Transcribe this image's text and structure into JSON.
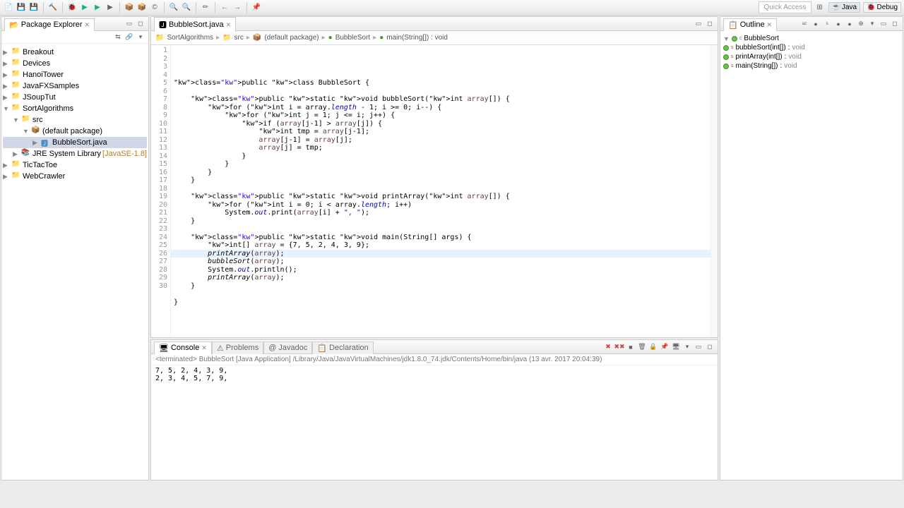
{
  "quickAccess": {
    "placeholder": "Quick Access"
  },
  "perspectives": {
    "java": "Java",
    "debug": "Debug"
  },
  "packageExplorer": {
    "title": "Package Explorer",
    "projects": [
      "Breakout",
      "Devices",
      "HanoiTower",
      "JavaFXSamples",
      "JSoupTut",
      "SortAlgorithms",
      "TicTacToe",
      "WebCrawler"
    ],
    "sort": {
      "src": "src",
      "defaultPkg": "(default package)",
      "file": "BubbleSort.java",
      "jre": "JRE System Library",
      "jreVer": "[JavaSE-1.8]"
    }
  },
  "editor": {
    "tab": "BubbleSort.java",
    "breadcrumb": {
      "project": "SortAlgorithms",
      "src": "src",
      "pkg": "(default package)",
      "class": "BubbleSort",
      "method": "main(String[]) : void"
    },
    "code": [
      "",
      "public class BubbleSort {",
      "",
      "    public static void bubbleSort(int array[]) {",
      "        for (int i = array.length - 1; i >= 0; i--) {",
      "            for (int j = 1; j <= i; j++) {",
      "                if (array[j-1] > array[j]) {",
      "                    int tmp = array[j-1];",
      "                    array[j-1] = array[j];",
      "                    array[j] = tmp;",
      "                }",
      "            }",
      "        }",
      "    }",
      "",
      "    public static void printArray(int array[]) {",
      "        for (int i = 0; i < array.length; i++)",
      "            System.out.print(array[i] + \", \");",
      "    }",
      "",
      "    public static void main(String[] args) {",
      "        int[] array = {7, 5, 2, 4, 3, 9};",
      "        printArray(array);",
      "        bubbleSort(array);",
      "        System.out.println();",
      "        printArray(array);",
      "    }",
      "",
      "}",
      ""
    ],
    "highlightLine": 26
  },
  "outline": {
    "title": "Outline",
    "class": "BubbleSort",
    "methods": [
      {
        "name": "bubbleSort(int[])",
        "ret": "void"
      },
      {
        "name": "printArray(int[])",
        "ret": "void"
      },
      {
        "name": "main(String[])",
        "ret": "void"
      }
    ]
  },
  "bottomTabs": {
    "console": "Console",
    "problems": "Problems",
    "javadoc": "Javadoc",
    "declaration": "Declaration"
  },
  "console": {
    "status": "<terminated> BubbleSort [Java Application] /Library/Java/JavaVirtualMachines/jdk1.8.0_74.jdk/Contents/Home/bin/java (13 avr. 2017 20:04:39)",
    "lines": [
      "7, 5, 2, 4, 3, 9, ",
      "2, 3, 4, 5, 7, 9, "
    ]
  }
}
